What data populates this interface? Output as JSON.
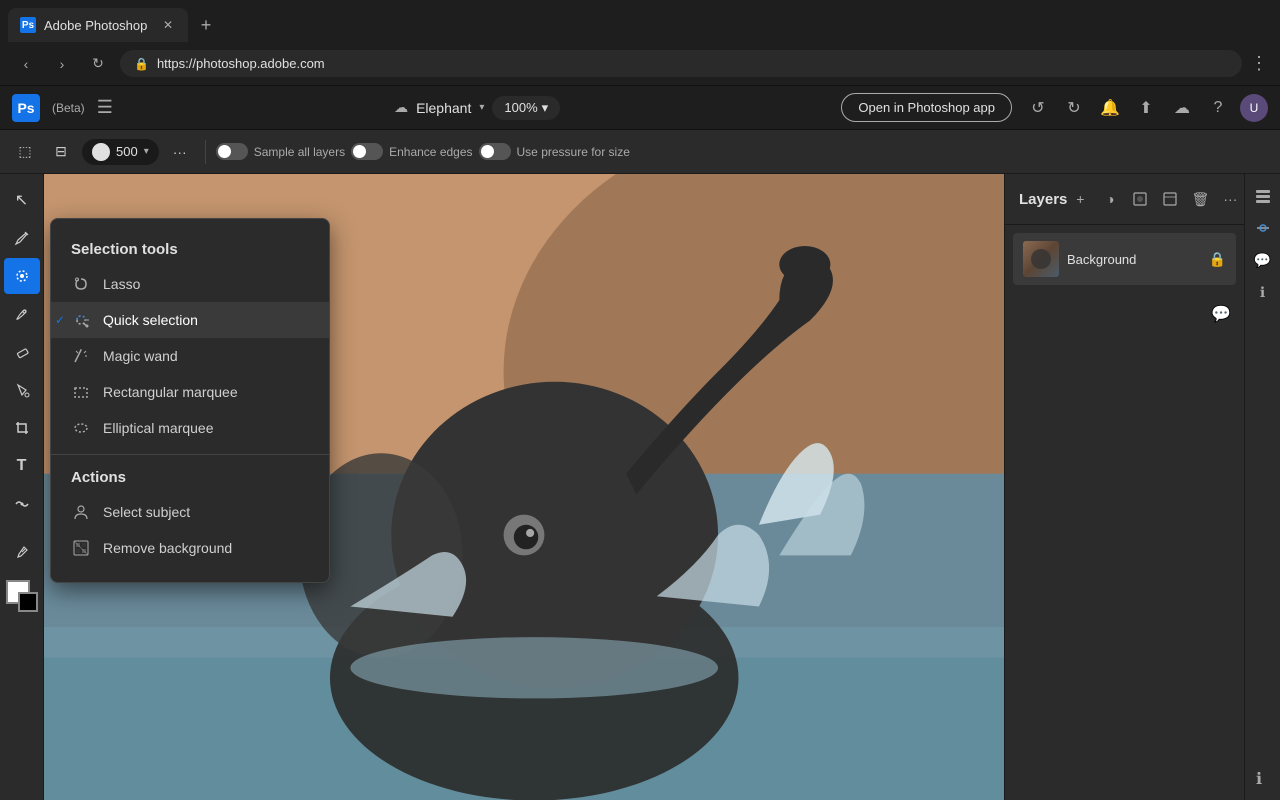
{
  "browser": {
    "tab_title": "Adobe Photoshop",
    "url": "https://photoshop.adobe.com",
    "new_tab_symbol": "+"
  },
  "app_header": {
    "logo_text": "Ps",
    "beta_label": "(Beta)",
    "file_name": "Elephant",
    "zoom_level": "100%",
    "open_btn_label": "Open in Photoshop app",
    "undo_symbol": "↺",
    "redo_symbol": "↻"
  },
  "top_toolbar": {
    "brush_size": "500",
    "more_label": "···",
    "sample_all_layers_label": "Sample all layers",
    "enhance_edges_label": "Enhance edges",
    "use_pressure_label": "Use pressure for size"
  },
  "selection_menu": {
    "section_title": "Selection tools",
    "items": [
      {
        "id": "lasso",
        "label": "Lasso",
        "icon": "⌖",
        "checked": false
      },
      {
        "id": "quick-selection",
        "label": "Quick selection",
        "icon": "⊕",
        "checked": true
      },
      {
        "id": "magic-wand",
        "label": "Magic wand",
        "icon": "✦",
        "checked": false
      },
      {
        "id": "rectangular-marquee",
        "label": "Rectangular marquee",
        "icon": "▭",
        "checked": false
      },
      {
        "id": "elliptical-marquee",
        "label": "Elliptical marquee",
        "icon": "◯",
        "checked": false
      }
    ],
    "actions_title": "Actions",
    "actions": [
      {
        "id": "select-subject",
        "label": "Select subject",
        "icon": "👤"
      },
      {
        "id": "remove-background",
        "label": "Remove background",
        "icon": "🖼"
      }
    ]
  },
  "layers_panel": {
    "title": "Layers",
    "layer_name": "Background",
    "icons": {
      "add": "+",
      "adjust": "◑",
      "mask": "□",
      "frame": "⊡",
      "delete": "🗑",
      "more": "···",
      "lock": "🔒"
    }
  },
  "left_tools": [
    {
      "id": "select-move",
      "symbol": "↖",
      "active": false
    },
    {
      "id": "pen",
      "symbol": "✒",
      "active": false
    },
    {
      "id": "quick-selection-tool",
      "symbol": "⊕",
      "active": true
    },
    {
      "id": "brush",
      "symbol": "🖌",
      "active": false
    },
    {
      "id": "eraser",
      "symbol": "◻",
      "active": false
    },
    {
      "id": "fill",
      "symbol": "⬟",
      "active": false
    },
    {
      "id": "crop",
      "symbol": "⊡",
      "active": false
    },
    {
      "id": "type",
      "symbol": "T",
      "active": false
    },
    {
      "id": "warp",
      "symbol": "⊗",
      "active": false
    },
    {
      "id": "eyedropper",
      "symbol": "⌀",
      "active": false
    },
    {
      "id": "hand",
      "symbol": "☰",
      "active": false
    }
  ]
}
